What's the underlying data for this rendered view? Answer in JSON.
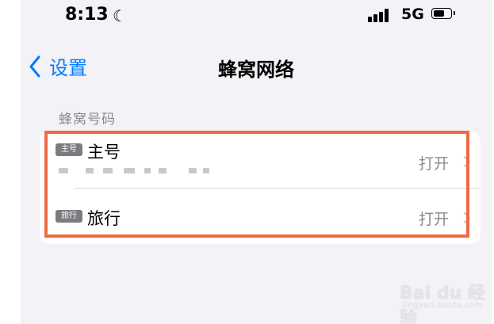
{
  "status_bar": {
    "time": "8:13",
    "moon_icon": "moon-icon",
    "signal_icon": "cellular-signal-icon",
    "network": "5G",
    "battery_icon": "battery-icon",
    "battery_level": 0.7
  },
  "nav": {
    "back_icon": "chevron-left-icon",
    "back_label": "设置",
    "title": "蜂窝网络",
    "accent_color": "#007aff"
  },
  "section": {
    "header": "蜂窝号码",
    "lines": [
      {
        "badge": "主号",
        "name": "主号",
        "value": "打开",
        "chevron_icon": "chevron-right-icon"
      },
      {
        "badge": "旅行",
        "name": "旅行",
        "value": "打开",
        "chevron_icon": "chevron-right-icon"
      }
    ]
  },
  "highlight_color": "#f06a45",
  "watermark": {
    "brand": "Bai du 经验",
    "sub": "jingyan.baidu.com"
  }
}
